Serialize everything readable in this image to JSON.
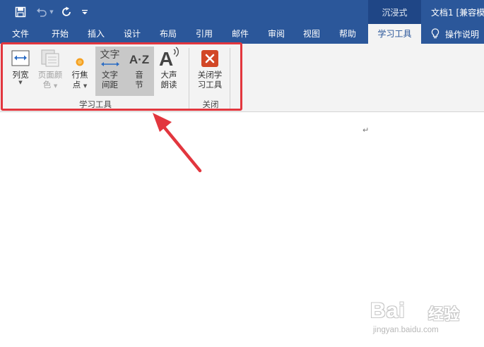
{
  "titlebar": {
    "mode_tab": "沉浸式",
    "doc_title": "文档1 [兼容模"
  },
  "tabs": [
    {
      "label": "文件"
    },
    {
      "label": "开始"
    },
    {
      "label": "插入"
    },
    {
      "label": "设计"
    },
    {
      "label": "布局"
    },
    {
      "label": "引用"
    },
    {
      "label": "邮件"
    },
    {
      "label": "审阅"
    },
    {
      "label": "视图"
    },
    {
      "label": "帮助"
    },
    {
      "label": "学习工具",
      "active": true
    }
  ],
  "tell_me": {
    "label": "操作说明",
    "icon": "lightbulb-icon"
  },
  "ribbon": {
    "buttons": [
      {
        "label_line1": "列宽",
        "caret": "▼",
        "icon": "column-width-icon",
        "enabled": true
      },
      {
        "label_line1": "页面颜",
        "label_line2": "色",
        "caret": "▼",
        "icon": "page-color-icon",
        "enabled": false
      },
      {
        "label_line1": "行焦",
        "label_line2": "点",
        "caret": "▼",
        "icon": "line-focus-icon",
        "enabled": true
      },
      {
        "label_line1": "文字",
        "label_line2": "间距",
        "icon": "text-spacing-icon",
        "icon_text": "文字",
        "selected": true,
        "enabled": true
      },
      {
        "label_line1": "音",
        "label_line2": "节",
        "icon": "syllables-icon",
        "icon_text": "A·Z",
        "selected": true,
        "enabled": true
      },
      {
        "label_line1": "大声",
        "label_line2": "朗读",
        "icon": "read-aloud-icon",
        "enabled": true
      },
      {
        "label_line1": "关闭学",
        "label_line2": "习工具",
        "icon": "close-x-icon",
        "enabled": true
      }
    ],
    "groups": [
      {
        "label": "学习工具"
      },
      {
        "label": "关闭"
      }
    ]
  },
  "document": {
    "pilcrow": "↵"
  },
  "watermark": {
    "main": "Bai",
    "cn": "经验",
    "url": "jingyan.baidu.com"
  },
  "colors": {
    "brand_blue": "#2b579a",
    "highlight_red": "#e2363e",
    "ribbon_bg": "#f3f3f3",
    "close_button_red": "#d24726"
  }
}
